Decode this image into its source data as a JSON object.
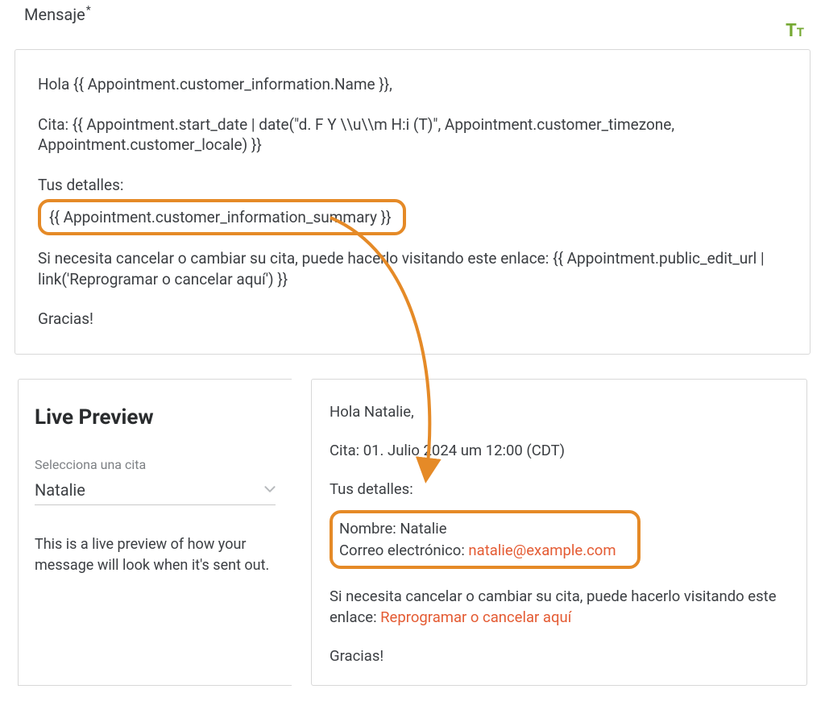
{
  "header": {
    "label": "Mensaje",
    "asterisk": "*"
  },
  "icons": {
    "text_tool": "TT"
  },
  "editor": {
    "greeting": "Hola {{ Appointment.customer_information.Name }},",
    "cita": "Cita: {{ Appointment.start_date | date(\"d. F Y \\\\u\\\\m H:i (T)\", Appointment.customer_timezone, Appointment.customer_locale) }}",
    "details_label": "Tus detalles:",
    "summary_var": "{{ Appointment.customer_information_summary }}",
    "cancel_text": "Si necesita cancelar o cambiar su cita, puede hacerlo visitando este enlace: {{ Appointment.public_edit_url | link('Reprogramar o cancelar aquí') }}",
    "thanks": "Gracias!"
  },
  "live_preview": {
    "title": "Live Preview",
    "select_label": "Selecciona una cita",
    "select_value": "Natalie",
    "description": "This is a live preview of how your message will look when it's sent out."
  },
  "preview_output": {
    "greeting": "Hola Natalie,",
    "cita": "Cita: 01. Julio 2024 um 12:00 (CDT)",
    "details_label": "Tus detalles:",
    "name_label": "Nombre: ",
    "name_value": "Natalie",
    "email_label": "Correo electrónico: ",
    "email_value": "natalie@example.com",
    "cancel_pre": "Si necesita cancelar o cambiar su cita, puede hacerlo visitando este enlace: ",
    "cancel_link": "Reprogramar o cancelar aquí",
    "thanks": "Gracias!"
  },
  "colors": {
    "highlight": "#e58a27",
    "link": "#e45b33",
    "tt": "#76a934"
  }
}
